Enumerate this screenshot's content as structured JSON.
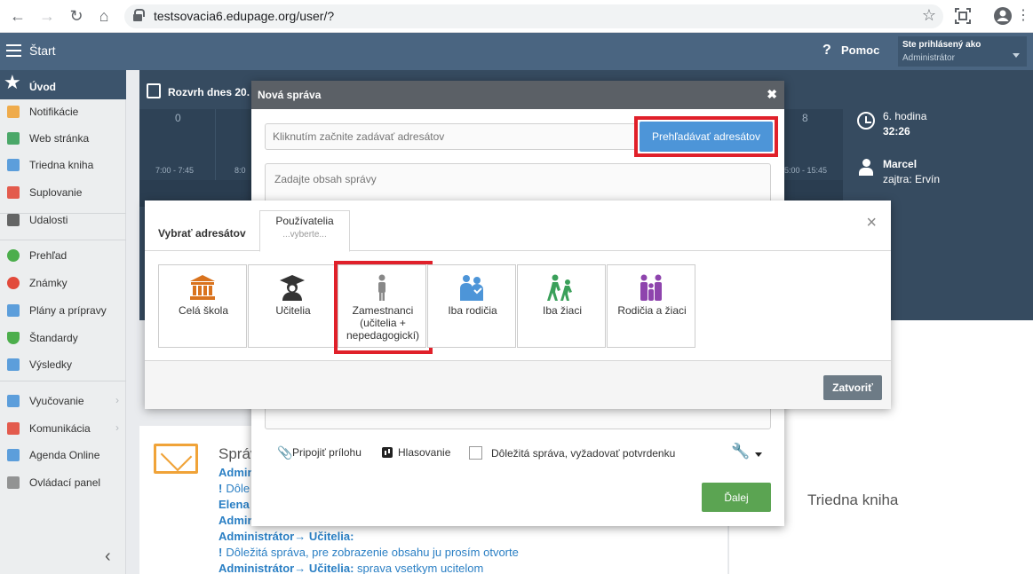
{
  "browser": {
    "url": "testsovacia6.edupage.org/user/?"
  },
  "appbar": {
    "title": "Štart",
    "help_label": "Pomoc",
    "logged_in_label": "Ste prihlásený ako",
    "logged_in_user": "Administrátor"
  },
  "sidebar": {
    "items": [
      {
        "label": "Úvod",
        "icon": "star-icon",
        "color": "#ffffff"
      },
      {
        "label": "Notifikácie",
        "icon": "envelope-icon",
        "color": "#f0a338"
      },
      {
        "label": "Web stránka",
        "icon": "house-icon",
        "color": "#3aa05a"
      },
      {
        "label": "Triedna kniha",
        "icon": "book-icon",
        "color": "#4d95d8"
      },
      {
        "label": "Suplovanie",
        "icon": "substitute-icon",
        "color": "#e24a3b"
      },
      {
        "label": "Udalosti",
        "icon": "calendar-icon",
        "color": "#555555"
      },
      {
        "label": "Prehľad",
        "icon": "check-circle-icon",
        "color": "#4cae4c"
      },
      {
        "label": "Známky",
        "icon": "grades-icon",
        "color": "#e24a3b"
      },
      {
        "label": "Plány a prípravy",
        "icon": "briefcase-icon",
        "color": "#4d95d8"
      },
      {
        "label": "Štandardy",
        "icon": "shield-check-icon",
        "color": "#4cae4c"
      },
      {
        "label": "Výsledky",
        "icon": "bar-chart-icon",
        "color": "#4d95d8"
      },
      {
        "label": "Vyučovanie",
        "icon": "teaching-icon",
        "color": "#4d95d8"
      },
      {
        "label": "Komunikácia",
        "icon": "chat-icon",
        "color": "#e24a3b"
      },
      {
        "label": "Agenda Online",
        "icon": "pen-icon",
        "color": "#4d95d8"
      },
      {
        "label": "Ovládací panel",
        "icon": "gear-icon",
        "color": "#888888"
      }
    ]
  },
  "timetable": {
    "title": "Rozvrh dnes 20.",
    "periods": [
      {
        "num": "0",
        "time": "7:00 - 7:45"
      },
      {
        "num": "",
        "time": "8:0"
      },
      {
        "num": "8",
        "time": "5:00 - 15:45"
      }
    ],
    "current_hour": "6. hodina",
    "countdown": "32:26",
    "teacher": "Marcel",
    "tomorrow": "zajtra: Ervín"
  },
  "messages_card": {
    "title": "Správ",
    "lines": [
      {
        "bold": "Admin",
        "text": ""
      },
      {
        "bold": "",
        "text": "Dôle",
        "excl": true
      },
      {
        "bold": "Elena",
        "text": ""
      },
      {
        "bold": "Admin",
        "text": ""
      },
      {
        "bold": "Administrátor→ Učitelia:",
        "text": ""
      },
      {
        "bold": "",
        "text": "Dôležitá správa, pre zobrazenie obsahu ju prosím otvorte",
        "excl": true
      },
      {
        "bold": "Administrátor→ Učitelia:",
        "text": " sprava vsetkym ucitelom"
      }
    ]
  },
  "triedna_card": {
    "title": "Triedna kniha"
  },
  "new_message": {
    "title": "Nová správa",
    "close": "✖",
    "recipients_placeholder": "Kliknutím začnite zadávať adresátov",
    "browse_button": "Prehľadávať adresátov",
    "body_placeholder": "Zadajte obsah správy",
    "attach_label": "Pripojiť prílohu",
    "poll_label": "Hlasovanie",
    "important_label": "Dôležitá správa, vyžadovať potvrdenku",
    "next_button": "Ďalej"
  },
  "recipients_dialog": {
    "title": "Vybrať adresátov",
    "tab_label": "Používatelia",
    "tab_sub": "...vyberte...",
    "close": "×",
    "tiles": [
      {
        "label": "Celá škola",
        "icon": "school-building-icon",
        "color": "#d9731e"
      },
      {
        "label": "Učitelia",
        "icon": "teacher-graduate-icon",
        "color": "#333333"
      },
      {
        "label": "Zamestnanci (učitelia + nepedagogickí)",
        "icon": "employee-icon",
        "color": "#888888"
      },
      {
        "label": "Iba rodičia",
        "icon": "parents-icon",
        "color": "#4d95d8"
      },
      {
        "label": "Iba žiaci",
        "icon": "students-icon",
        "color": "#3aa05a"
      },
      {
        "label": "Rodičia a žiaci",
        "icon": "family-icon",
        "color": "#8e44ad"
      }
    ],
    "close_button": "Zatvoriť"
  }
}
